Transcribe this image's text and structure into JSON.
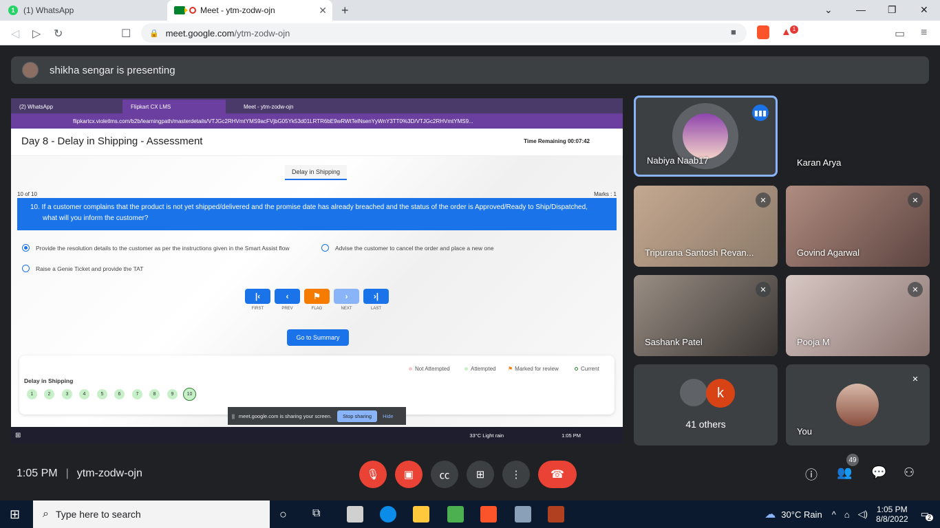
{
  "browser": {
    "tabs": [
      {
        "label": "(1) WhatsApp",
        "badge": "1"
      },
      {
        "label": "Meet - ytm-zodw-ojn"
      }
    ],
    "url_domain": "meet.google.com",
    "url_path": "/ytm-zodw-ojn",
    "notif_count": "1"
  },
  "presenting": {
    "text": "shikha sengar is presenting"
  },
  "shared_screen": {
    "tabs": [
      "(2) WhatsApp",
      "Flipkart CX LMS",
      "Meet - ytm-zodw-ojn"
    ],
    "url": "flipkartcx.violetlms.com/b2b/learningpath/masterdetails/VTJGc2RHVmtYMS9acFVjbG05Yk53d01LRTR6bE9wRWtTelNsenYyWnY3TT0%3D/VTJGc2RHVmtYMS9...",
    "title": "Day 8 - Delay in Shipping - Assessment",
    "time_remaining": "Time Remaining 00:07:42",
    "section_tab": "Delay in Shipping",
    "question_count": "10 of 10",
    "marks": "Marks : 1",
    "question": "10. If a customer complains that the product is not yet shipped/delivered and the promise date has already breached and the status of the order is Approved/Ready to Ship/Dispatched, what will you inform the customer?",
    "options": [
      {
        "text": "Provide the resolution details to the customer as per the instructions given in the Smart Assist flow",
        "selected": true
      },
      {
        "text": "Advise the customer to cancel the order and place a new one",
        "selected": false
      },
      {
        "text": "Raise a Genie Ticket and provide the TAT",
        "selected": false
      }
    ],
    "nav_buttons": [
      {
        "label": "FIRST",
        "icon": "first-icon",
        "color": "#1a73e8"
      },
      {
        "label": "PREV",
        "icon": "prev-icon",
        "color": "#1a73e8"
      },
      {
        "label": "FLAG",
        "icon": "flag-icon",
        "color": "#f57c00"
      },
      {
        "label": "NEXT",
        "icon": "next-icon",
        "color": "#8ab4f8"
      },
      {
        "label": "LAST",
        "icon": "last-icon",
        "color": "#1a73e8"
      }
    ],
    "summary_button": "Go to Summary",
    "legend": [
      "Not Attempted",
      "Attempted",
      "Marked for review",
      "Current"
    ],
    "palette_title": "Delay in Shipping",
    "question_numbers": [
      "1",
      "2",
      "3",
      "4",
      "5",
      "6",
      "7",
      "8",
      "9",
      "10"
    ],
    "share_notice": "meet.google.com is sharing your screen.",
    "stop_sharing": "Stop sharing",
    "hide": "Hide",
    "taskbar_weather": "33°C  Light rain",
    "taskbar_time": "1:05 PM"
  },
  "participants": [
    {
      "name": "Nabiya Naab17",
      "speaking": true
    },
    {
      "name": "Karan Arya",
      "muted": false
    },
    {
      "name": "Tripurana Santosh Revan...",
      "muted": true
    },
    {
      "name": "Govind Agarwal",
      "muted": true
    },
    {
      "name": "Sashank Patel",
      "muted": true
    },
    {
      "name": "Pooja M",
      "muted": true
    },
    {
      "name": "41 others",
      "avatar_letter": "k"
    },
    {
      "name": "You",
      "muted": true
    }
  ],
  "meeting": {
    "time": "1:05 PM",
    "code": "ytm-zodw-ojn",
    "people_count": "49"
  },
  "windows": {
    "search_placeholder": "Type here to search",
    "weather": "30°C  Rain",
    "time": "1:05 PM",
    "date": "8/8/2022",
    "notif_count": "2"
  }
}
